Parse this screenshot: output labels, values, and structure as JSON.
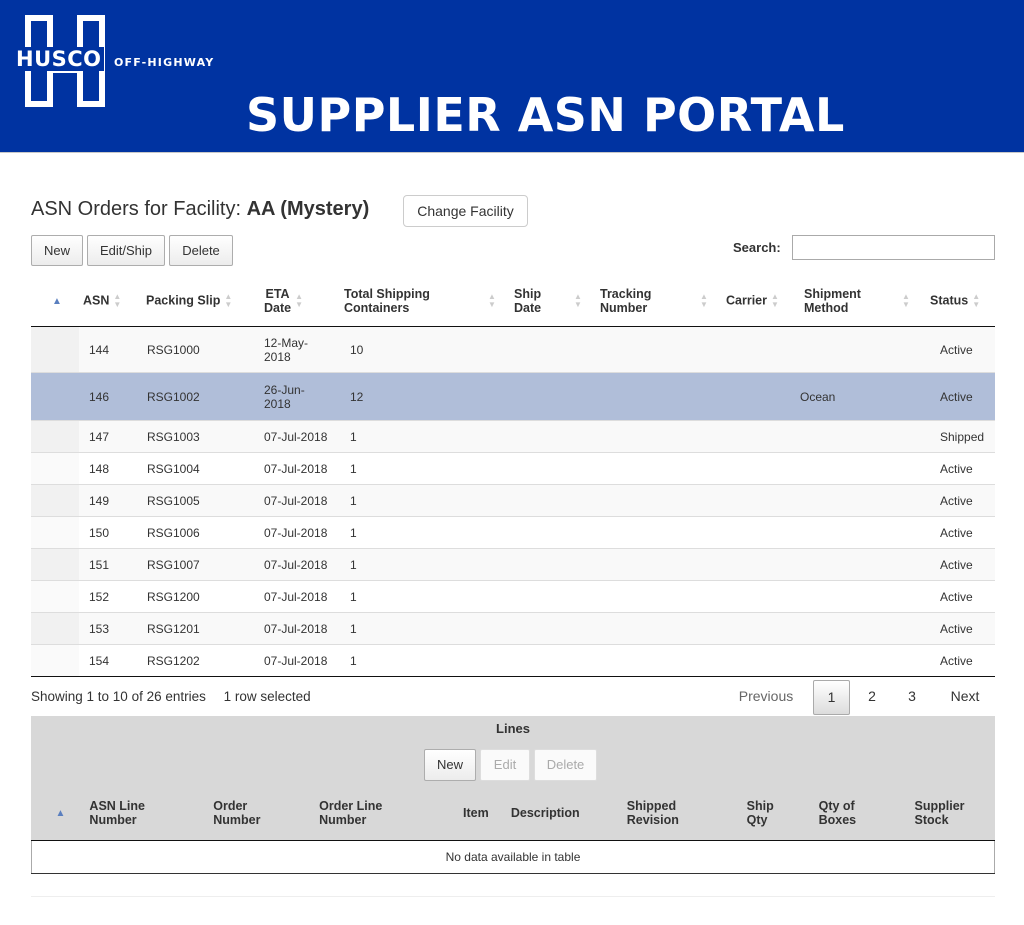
{
  "header": {
    "logo_text": "HUSCO",
    "logo_sub": "OFF-HIGHWAY",
    "portal_title": "SUPPLIER ASN PORTAL",
    "colors": {
      "banner": "#0033a1",
      "selected_row": "#b0bed9"
    }
  },
  "facility": {
    "prefix": "ASN Orders for Facility:",
    "name": "AA (Mystery)",
    "change_label": "Change Facility"
  },
  "toolbar": {
    "new_label": "New",
    "editship_label": "Edit/Ship",
    "delete_label": "Delete"
  },
  "search": {
    "label": "Search:",
    "value": ""
  },
  "table": {
    "columns": {
      "asn": "ASN",
      "packing_slip": "Packing Slip",
      "eta_1": "ETA",
      "eta_2": "Date",
      "total_1": "Total Shipping",
      "total_2": "Containers",
      "ship_1": "Ship",
      "ship_2": "Date",
      "tracking_1": "Tracking",
      "tracking_2": "Number",
      "carrier": "Carrier",
      "method_1": "Shipment",
      "method_2": "Method",
      "status": "Status"
    },
    "rows": [
      {
        "asn": "144",
        "slip": "RSG1000",
        "eta1": "12-May-",
        "eta2": "2018",
        "containers": "10",
        "ship": "",
        "tracking": "",
        "carrier": "",
        "method": "",
        "status": "Active"
      },
      {
        "asn": "146",
        "slip": "RSG1002",
        "eta1": "26-Jun-",
        "eta2": "2018",
        "containers": "12",
        "ship": "",
        "tracking": "",
        "carrier": "",
        "method": "Ocean",
        "status": "Active"
      },
      {
        "asn": "147",
        "slip": "RSG1003",
        "eta1": "07-Jul-2018",
        "eta2": "",
        "containers": "1",
        "ship": "",
        "tracking": "",
        "carrier": "",
        "method": "",
        "status": "Shipped"
      },
      {
        "asn": "148",
        "slip": "RSG1004",
        "eta1": "07-Jul-2018",
        "eta2": "",
        "containers": "1",
        "ship": "",
        "tracking": "",
        "carrier": "",
        "method": "",
        "status": "Active"
      },
      {
        "asn": "149",
        "slip": "RSG1005",
        "eta1": "07-Jul-2018",
        "eta2": "",
        "containers": "1",
        "ship": "",
        "tracking": "",
        "carrier": "",
        "method": "",
        "status": "Active"
      },
      {
        "asn": "150",
        "slip": "RSG1006",
        "eta1": "07-Jul-2018",
        "eta2": "",
        "containers": "1",
        "ship": "",
        "tracking": "",
        "carrier": "",
        "method": "",
        "status": "Active"
      },
      {
        "asn": "151",
        "slip": "RSG1007",
        "eta1": "07-Jul-2018",
        "eta2": "",
        "containers": "1",
        "ship": "",
        "tracking": "",
        "carrier": "",
        "method": "",
        "status": "Active"
      },
      {
        "asn": "152",
        "slip": "RSG1200",
        "eta1": "07-Jul-2018",
        "eta2": "",
        "containers": "1",
        "ship": "",
        "tracking": "",
        "carrier": "",
        "method": "",
        "status": "Active"
      },
      {
        "asn": "153",
        "slip": "RSG1201",
        "eta1": "07-Jul-2018",
        "eta2": "",
        "containers": "1",
        "ship": "",
        "tracking": "",
        "carrier": "",
        "method": "",
        "status": "Active"
      },
      {
        "asn": "154",
        "slip": "RSG1202",
        "eta1": "07-Jul-2018",
        "eta2": "",
        "containers": "1",
        "ship": "",
        "tracking": "",
        "carrier": "",
        "method": "",
        "status": "Active"
      }
    ]
  },
  "info": {
    "showing": "Showing 1 to 10 of 26 entries",
    "selected": "1 row selected"
  },
  "pager": {
    "previous": "Previous",
    "p1": "1",
    "p2": "2",
    "p3": "3",
    "next": "Next"
  },
  "lines": {
    "title": "Lines",
    "new_label": "New",
    "edit_label": "Edit",
    "delete_label": "Delete",
    "columns": {
      "line_1": "ASN Line",
      "line_2": "Number",
      "order_1": "Order",
      "order_2": "Number",
      "orderline_1": "Order Line",
      "orderline_2": "Number",
      "item": "Item",
      "description": "Description",
      "rev_1": "Shipped",
      "rev_2": "Revision",
      "qty_1": "Ship",
      "qty_2": "Qty",
      "boxes_1": "Qty of",
      "boxes_2": "Boxes",
      "stock_1": "Supplier",
      "stock_2": "Stock"
    },
    "empty": "No data available in table"
  }
}
